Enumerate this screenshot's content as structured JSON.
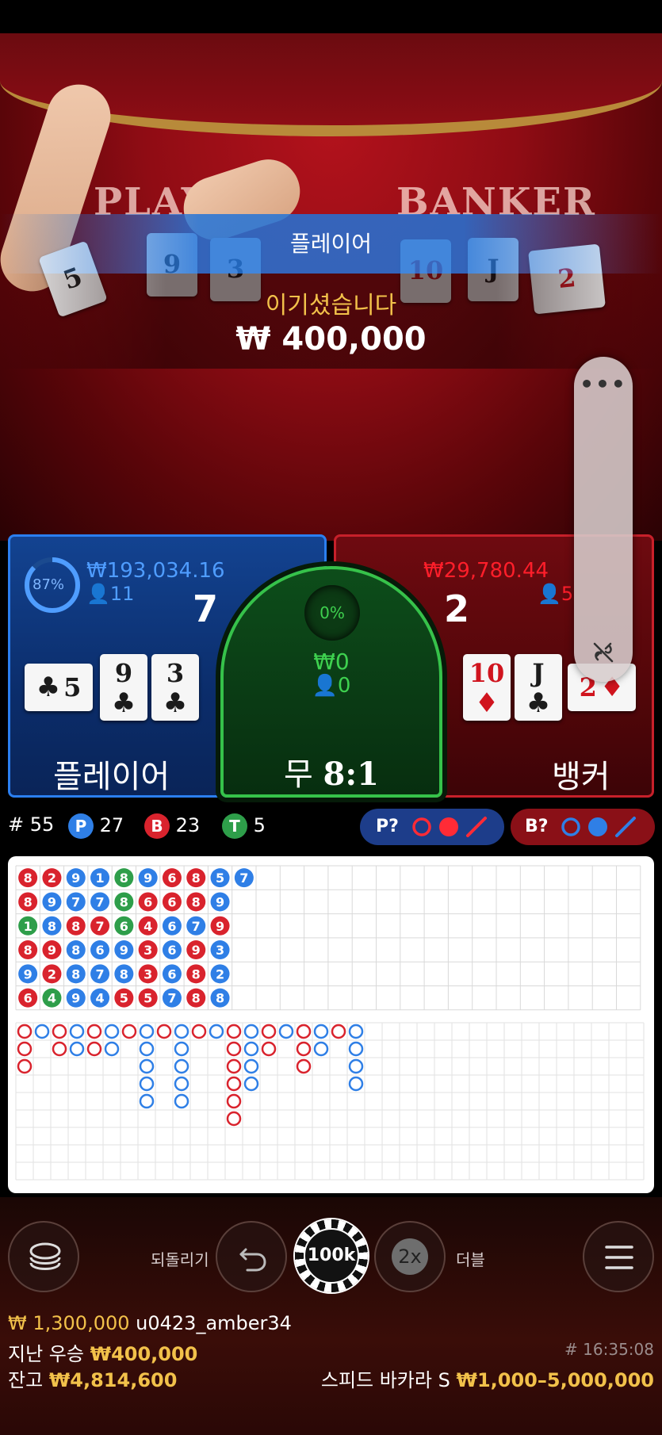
{
  "video": {
    "felt_player": "PLAY",
    "felt_banker": "BANKER",
    "dealt_player_cards": [
      {
        "rank": "9",
        "suit": "♣"
      },
      {
        "rank": "3",
        "suit": "♣"
      }
    ],
    "dealt_banker_cards": [
      {
        "rank": "10",
        "suit": "♦"
      },
      {
        "rank": "J",
        "suit": "♣"
      },
      {
        "rank": "2",
        "suit": "♦"
      }
    ]
  },
  "result": {
    "winner_label": "플레이어",
    "message": "이기셨습니다",
    "amount": "₩ 400,000"
  },
  "side_menu": {
    "more_label": "•••",
    "icon": "no-link-icon"
  },
  "bets": {
    "player": {
      "win_percent": "87%",
      "win_fraction": 0.87,
      "total_bet": "₩193,034.16",
      "players": "11",
      "score": "7",
      "label": "플레이어",
      "cards": [
        {
          "rank": "5",
          "suit": "♣",
          "color": "blk"
        },
        {
          "rank": "9",
          "suit": "♣",
          "color": "blk"
        },
        {
          "rank": "3",
          "suit": "♣",
          "color": "blk"
        }
      ]
    },
    "tie": {
      "win_percent": "0%",
      "total_bet": "₩0",
      "players": "0",
      "label": "무",
      "payout": "8:1"
    },
    "banker": {
      "total_bet": "₩29,780.44",
      "players": "5",
      "score": "2",
      "label": "뱅커",
      "cards": [
        {
          "rank": "10",
          "suit": "♦",
          "color": "red"
        },
        {
          "rank": "J",
          "suit": "♣",
          "color": "blk"
        },
        {
          "rank": "2",
          "suit": "♦",
          "color": "red"
        }
      ]
    }
  },
  "stats": {
    "round": "# 55",
    "player_letter": "P",
    "player_count": "27",
    "banker_letter": "B",
    "banker_count": "23",
    "tie_letter": "T",
    "tie_count": "5",
    "player_predict": "P?",
    "banker_predict": "B?"
  },
  "colors": {
    "player": "#2f7fe6",
    "banker": "#d9232d",
    "tie": "#2e9e4a",
    "gold": "#f2c14a"
  },
  "bead_road": [
    [
      "8B",
      "8B",
      "1T",
      "8B",
      "9P",
      "6B"
    ],
    [
      "2B",
      "9P",
      "8P",
      "9B",
      "2B",
      "4T"
    ],
    [
      "9P",
      "7P",
      "8B",
      "8P",
      "8P",
      "9P"
    ],
    [
      "1P",
      "7P",
      "7B",
      "6P",
      "7P",
      "4P"
    ],
    [
      "8T",
      "8T",
      "6T",
      "9P",
      "8P",
      "5B"
    ],
    [
      "9P",
      "6B",
      "4B",
      "3B",
      "3B",
      "5B"
    ],
    [
      "6B",
      "6B",
      "6P",
      "6P",
      "6P",
      "7P"
    ],
    [
      "8B",
      "8B",
      "7P",
      "9B",
      "8B",
      "8B"
    ],
    [
      "5P",
      "9P",
      "9B",
      "3P",
      "2P",
      "8P"
    ],
    [
      "7P"
    ]
  ],
  "controls": {
    "undo_label": "되돌리기",
    "chip_value": "100k",
    "double_value": "2x",
    "double_label": "더블"
  },
  "footer": {
    "bet_amount": "₩ 1,300,000",
    "username": "u0423_amber34",
    "last_win_label": "지난 우승",
    "last_win_amount": "₩400,000",
    "balance_label": "잔고",
    "balance_amount": "₩4,814,600",
    "time": "# 16:35:08",
    "table_name": "스피드 바카라 S",
    "limits": "₩1,000–5,000,000"
  }
}
